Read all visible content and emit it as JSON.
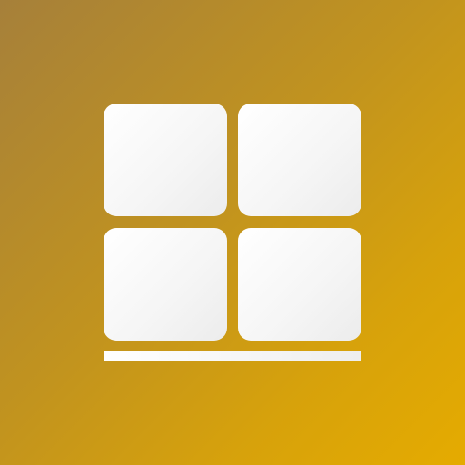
{
  "app_icon": {
    "icon": "tile-grid-icon",
    "tiles": 4,
    "colors": {
      "background_start": "#a6803a",
      "background_end": "#e5ab00",
      "glyph": "#ffffff"
    }
  }
}
